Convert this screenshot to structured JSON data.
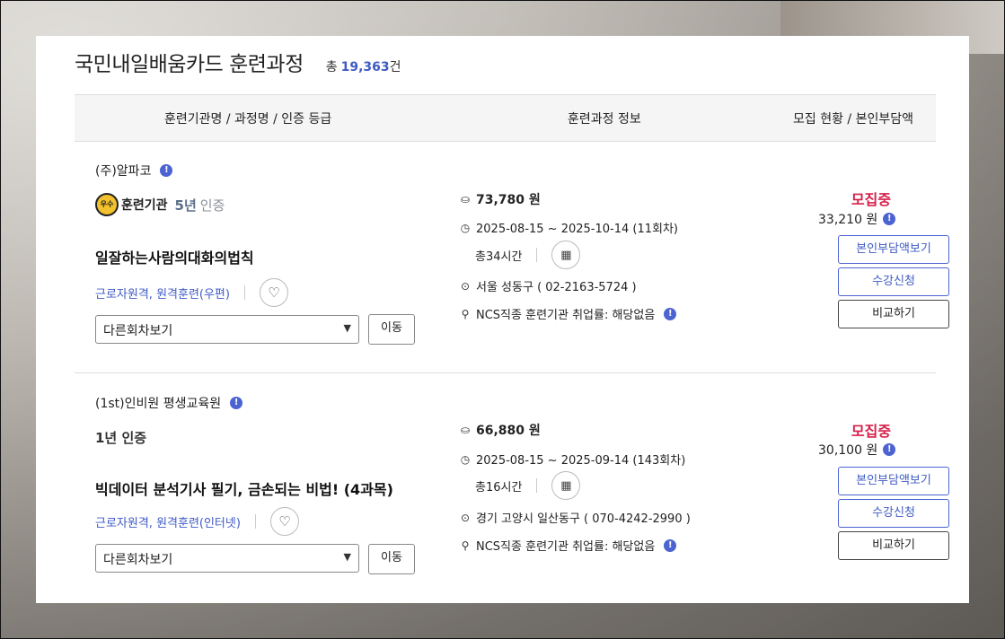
{
  "header": {
    "title": "국민내일배움카드 훈련과정",
    "total_prefix": "총",
    "total_count": "19,363",
    "total_suffix": "건"
  },
  "columns": [
    "훈련기관명 / 과정명 / 인증 등급",
    "훈련과정 정보",
    "모집 현황 / 본인부담액"
  ],
  "courses": [
    {
      "org": "(주)알파코",
      "badge_org": "훈련기관",
      "badge_years": "5년",
      "badge_suffix": "인증",
      "title": "일잘하는사람의대화의법칙",
      "type": "근로자원격, 원격훈련(우편)",
      "session_select": "다른회차보기",
      "move": "이동",
      "price": "73,780 원",
      "period": "2025-08-15 ~ 2025-10-14 (11회차)",
      "hours": "총34시간",
      "location": "서울 성동구 ( 02-2163-5724 )",
      "ncs": "NCS직종 훈련기관 취업률: 해당없음",
      "status": "모집중",
      "copay": "33,210 원",
      "btn_copay": "본인부담액보기",
      "btn_apply": "수강신청",
      "btn_compare": "비교하기"
    },
    {
      "org": "(1st)인비원 평생교육원",
      "badge_years": "1년",
      "badge_suffix": "인증",
      "title": "빅데이터 분석기사 필기, 금손되는 비법! (4과목)",
      "type": "근로자원격, 원격훈련(인터넷)",
      "session_select": "다른회차보기",
      "move": "이동",
      "price": "66,880 원",
      "period": "2025-08-15 ~ 2025-09-14 (143회차)",
      "hours": "총16시간",
      "location": "경기 고양시 일산동구 ( 070-4242-2990 )",
      "ncs": "NCS직종 훈련기관 취업률: 해당없음",
      "status": "모집중",
      "copay": "30,100 원",
      "btn_copay": "본인부담액보기",
      "btn_apply": "수강신청",
      "btn_compare": "비교하기"
    }
  ],
  "icons": {
    "info": "info-icon",
    "heart": "heart-icon",
    "coin": "coin-icon",
    "clock": "clock-icon",
    "calendar": "calendar-icon",
    "location": "location-pin-icon",
    "person": "person-icon"
  },
  "colors": {
    "accent": "#3f5bc4",
    "status": "#d6204b",
    "badge": "#f2c12e"
  }
}
